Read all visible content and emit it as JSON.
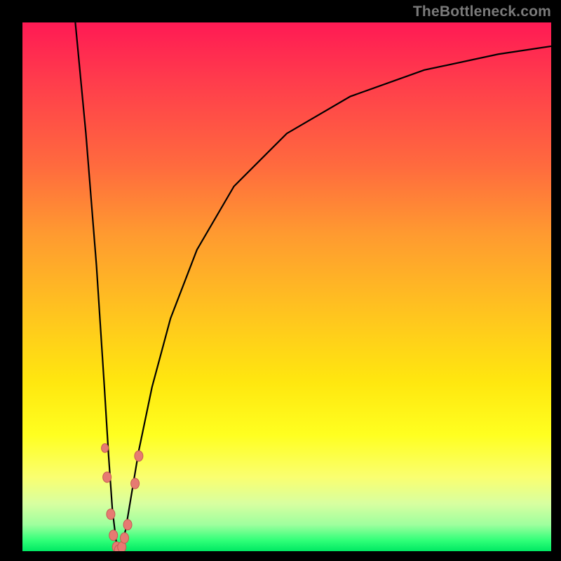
{
  "attribution": "TheBottleneck.com",
  "colors": {
    "top": "#ff1a54",
    "mid": "#ffe70f",
    "bottom": "#00e863",
    "curve": "#000000",
    "point_fill": "#e67a72",
    "point_stroke": "#c55a52"
  },
  "chart_data": {
    "type": "line",
    "title": "",
    "xlabel": "",
    "ylabel": "",
    "xlim": [
      0,
      100
    ],
    "ylim": [
      0,
      100
    ],
    "description": "V-shaped bottleneck curve: steep descent on the left, minimum near x≈18, rising asymptote toward upper-right. Y=0 is the 'perfect balance' (green) band at the bottom; Y=100 is maximum bottleneck (red). Scattered data points cluster near the trough.",
    "curve": [
      {
        "x": 10.0,
        "y": 100.0
      },
      {
        "x": 12.0,
        "y": 79.0
      },
      {
        "x": 14.0,
        "y": 54.0
      },
      {
        "x": 15.5,
        "y": 31.0
      },
      {
        "x": 16.3,
        "y": 18.0
      },
      {
        "x": 17.0,
        "y": 8.0
      },
      {
        "x": 17.7,
        "y": 2.0
      },
      {
        "x": 18.2,
        "y": 0.0
      },
      {
        "x": 18.8,
        "y": 1.0
      },
      {
        "x": 19.5,
        "y": 4.0
      },
      {
        "x": 20.5,
        "y": 10.0
      },
      {
        "x": 22.0,
        "y": 19.0
      },
      {
        "x": 24.5,
        "y": 31.0
      },
      {
        "x": 28.0,
        "y": 44.0
      },
      {
        "x": 33.0,
        "y": 57.0
      },
      {
        "x": 40.0,
        "y": 69.0
      },
      {
        "x": 50.0,
        "y": 79.0
      },
      {
        "x": 62.0,
        "y": 86.0
      },
      {
        "x": 76.0,
        "y": 91.0
      },
      {
        "x": 90.0,
        "y": 94.0
      },
      {
        "x": 100.0,
        "y": 95.5
      }
    ],
    "points": [
      {
        "x": 15.6,
        "y": 19.5,
        "r": 5
      },
      {
        "x": 16.0,
        "y": 14.0,
        "r": 6
      },
      {
        "x": 16.7,
        "y": 7.0,
        "r": 6
      },
      {
        "x": 17.2,
        "y": 3.0,
        "r": 6
      },
      {
        "x": 17.8,
        "y": 0.8,
        "r": 6
      },
      {
        "x": 18.2,
        "y": 0.2,
        "r": 6
      },
      {
        "x": 18.8,
        "y": 0.8,
        "r": 6
      },
      {
        "x": 19.3,
        "y": 2.5,
        "r": 6
      },
      {
        "x": 19.9,
        "y": 5.0,
        "r": 6
      },
      {
        "x": 21.3,
        "y": 12.8,
        "r": 6
      },
      {
        "x": 22.0,
        "y": 18.0,
        "r": 6
      }
    ]
  }
}
